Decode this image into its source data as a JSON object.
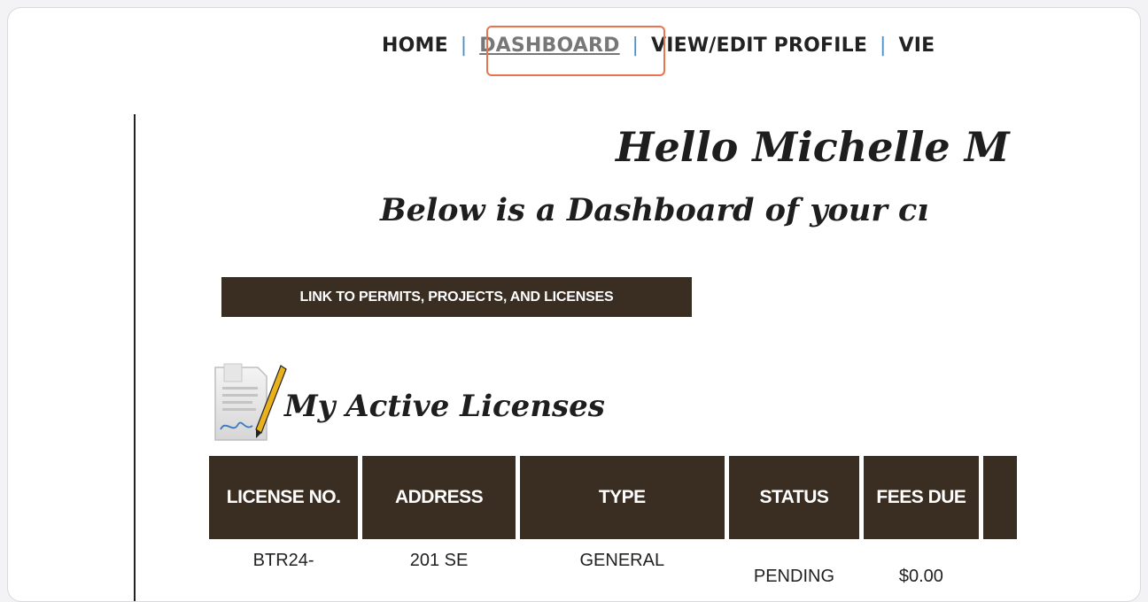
{
  "nav": {
    "home": "HOME",
    "sep": "|",
    "dashboard": "DASHBOARD",
    "view_edit_profile": "VIEW/EDIT PROFILE",
    "view_partial": "VIE"
  },
  "greeting": "Hello Michelle M",
  "subheading": "Below is a Dashboard of your cı",
  "link_button": "LINK TO PERMITS, PROJECTS, AND LICENSES",
  "licenses": {
    "title": "My Active Licenses",
    "icon": "license-document-pen-icon",
    "columns": [
      "LICENSE NO.",
      "ADDRESS",
      "TYPE",
      "STATUS",
      "FEES DUE",
      ""
    ],
    "rows": [
      {
        "license_no": "BTR24-",
        "address": "201 SE",
        "type": "GENERAL",
        "status": "PENDING",
        "fees_due": "$0.00"
      }
    ]
  },
  "colors": {
    "header_bg": "#3a2e22",
    "highlight": "#e8744f",
    "nav_sep": "#4a90c8"
  }
}
